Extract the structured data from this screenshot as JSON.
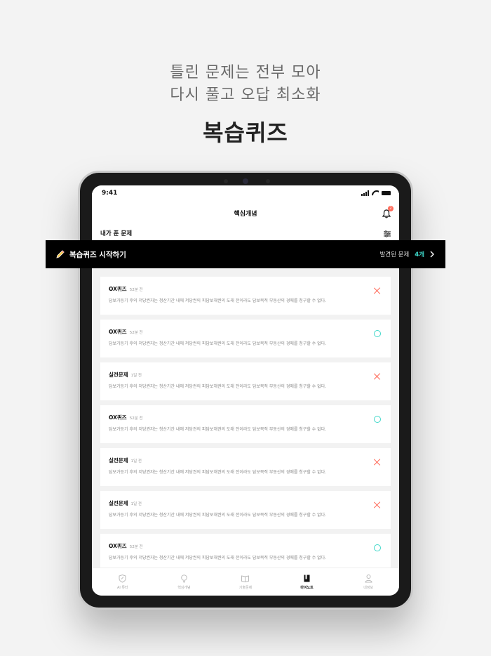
{
  "headline": {
    "line1": "틀린 문제는 전부 모아",
    "line2": "다시 풀고 오답 최소화",
    "title": "복습퀴즈"
  },
  "status": {
    "time": "9:41"
  },
  "nav": {
    "title": "핵심개념",
    "badge": "2"
  },
  "section": {
    "title": "내가 푼 문제"
  },
  "banner": {
    "label": "복습퀴즈 시작하기",
    "found_label": "발견된 문제",
    "found_count": "4개",
    "accent": "#3ed7c9"
  },
  "cards": [
    {
      "type": "OX퀴즈",
      "time": "52분 전",
      "desc": "담보가등기 후의 저당권자는 청산기간 내에 저당권의 피담보채권의 도래 전이라도 담보목적 부동산의 경매를 청구할 수 없다.",
      "result": "wrong"
    },
    {
      "type": "OX퀴즈",
      "time": "52분 전",
      "desc": "담보가등기 후의 저당권자는 청산기간 내에 저당권의 피담보채권의 도래 전이라도 담보목적 부동산의 경매를 청구할 수 없다.",
      "result": "correct"
    },
    {
      "type": "실전문제",
      "time": "1일 전",
      "desc": "담보가등기 후의 저당권자는 청산기간 내에 저당권의 피담보채권의 도래 전이라도 담보목적 부동산의 경매를 청구할 수 없다.",
      "result": "wrong"
    },
    {
      "type": "OX퀴즈",
      "time": "52분 전",
      "desc": "담보가등기 후의 저당권자는 청산기간 내에 저당권의 피담보채권의 도래 전이라도 담보목적 부동산의 경매를 청구할 수 없다.",
      "result": "correct"
    },
    {
      "type": "실전문제",
      "time": "1일 전",
      "desc": "담보가등기 후의 저당권자는 청산기간 내에 저당권의 피담보채권의 도래 전이라도 담보목적 부동산의 경매를 청구할 수 없다.",
      "result": "wrong"
    },
    {
      "type": "실전문제",
      "time": "1일 전",
      "desc": "담보가등기 후의 저당권자는 청산기간 내에 저당권의 피담보채권의 도래 전이라도 담보목적 부동산의 경매를 청구할 수 없다.",
      "result": "wrong"
    },
    {
      "type": "OX퀴즈",
      "time": "52분 전",
      "desc": "담보가등기 후의 저당권자는 청산기간 내에 저당권의 피담보채권의 도래 전이라도 담보목적 부동산의 경매를 청구할 수 없다.",
      "result": "correct"
    }
  ],
  "tabs": [
    {
      "label": "AI 튜터",
      "icon": "shield-icon",
      "active": false
    },
    {
      "label": "핵심개념",
      "icon": "lightbulb-icon",
      "active": false
    },
    {
      "label": "기출문제",
      "icon": "book-icon",
      "active": false
    },
    {
      "label": "마이노트",
      "icon": "note-icon",
      "active": true
    },
    {
      "label": "내정보",
      "icon": "person-icon",
      "active": false
    }
  ],
  "colors": {
    "wrong": "#ff6b5a",
    "correct": "#3ed7c9"
  }
}
